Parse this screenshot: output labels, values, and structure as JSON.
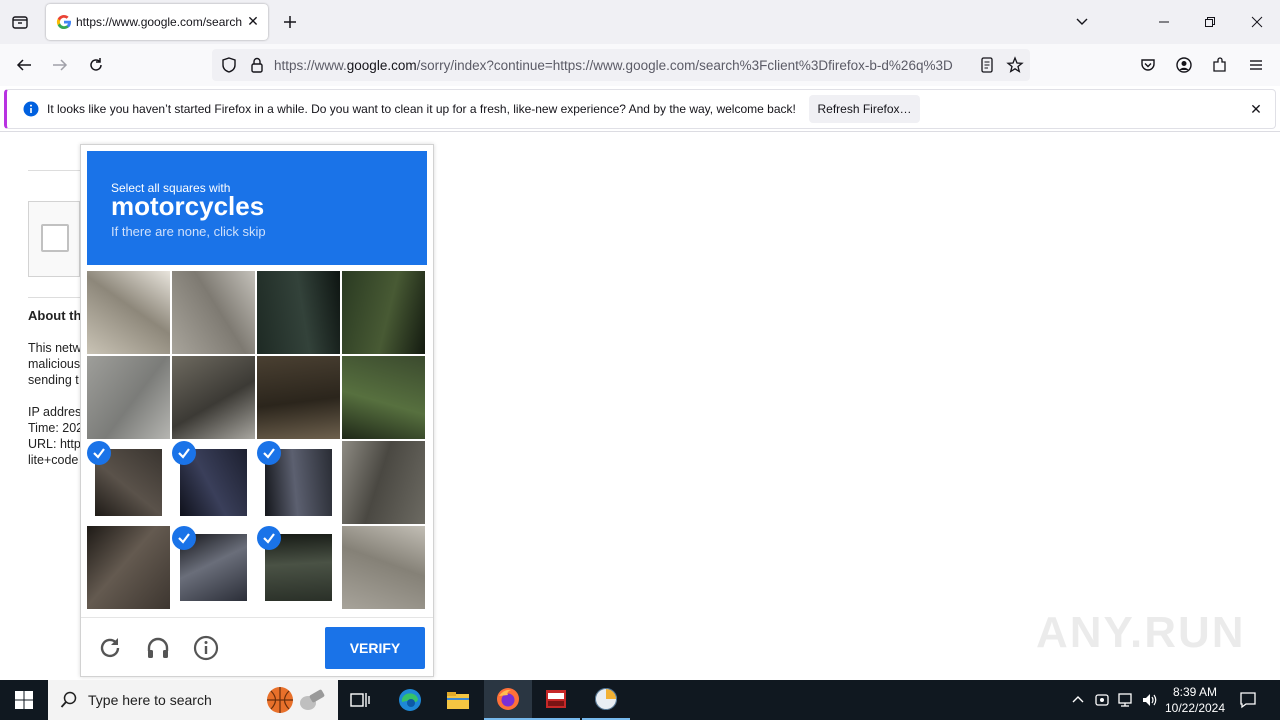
{
  "browser": {
    "tab_title": "https://www.google.com/search",
    "url_prefix": "https://www.",
    "url_domain": "google.com",
    "url_rest": "/sorry/index?continue=https://www.google.com/search%3Fclient%3Dfirefox-b-d%26q%3D",
    "notification": "It looks like you haven’t started Firefox in a while. Do you want to clean it up for a fresh, like-new experience? And by the way, welcome back!",
    "notification_button": "Refresh Firefox…"
  },
  "page": {
    "about_heading": "About th",
    "para1": [
      "This netw",
      "malicious",
      "sending t"
    ],
    "para2": [
      "IP addres",
      "Time: 202",
      "URL: http",
      "lite+code"
    ]
  },
  "captcha": {
    "header_line1": "Select all squares with",
    "header_target": "motorcycles",
    "header_line3": "If there are none, click skip",
    "selected_tiles": [
      8,
      9,
      10,
      13,
      14
    ],
    "verify_label": "VERIFY"
  },
  "taskbar": {
    "search_placeholder": "Type here to search",
    "time": "8:39 AM",
    "date": "10/22/2024"
  },
  "watermark": "ANY.RUN",
  "colors": {
    "accent": "#1a73e8",
    "taskbar": "#101820"
  }
}
